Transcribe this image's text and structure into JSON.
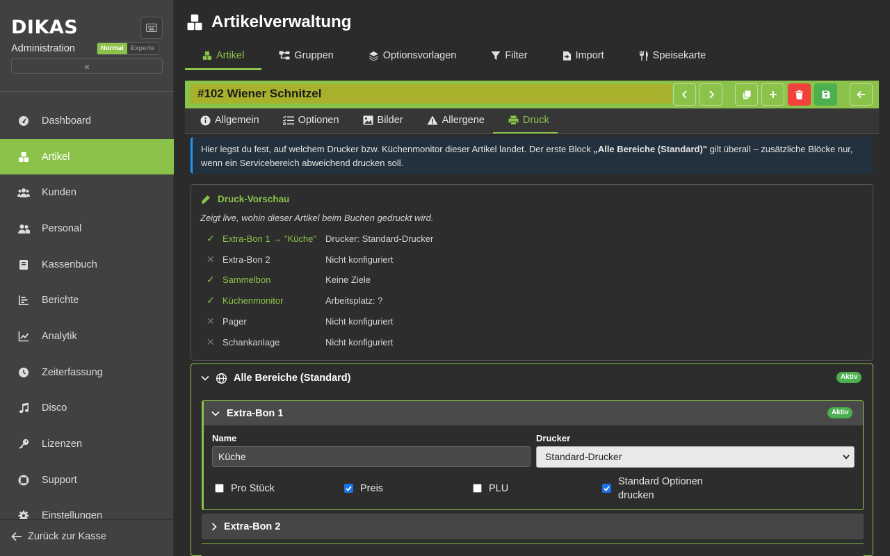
{
  "sidebar": {
    "logo": "DIKAS",
    "subtitle": "Administration",
    "mode_normal": "Normal",
    "mode_expert": "Experte",
    "collapse_symbol": "«",
    "items": [
      {
        "label": "Dashboard",
        "icon": "dashboard-icon"
      },
      {
        "label": "Artikel",
        "icon": "cubes-icon",
        "active": true
      },
      {
        "label": "Kunden",
        "icon": "users-icon"
      },
      {
        "label": "Personal",
        "icon": "user-group-icon"
      },
      {
        "label": "Kassenbuch",
        "icon": "book-icon"
      },
      {
        "label": "Berichte",
        "icon": "bar-chart-icon"
      },
      {
        "label": "Analytik",
        "icon": "line-chart-icon"
      },
      {
        "label": "Zeiterfassung",
        "icon": "clock-icon"
      },
      {
        "label": "Disco",
        "icon": "music-icon"
      },
      {
        "label": "Lizenzen",
        "icon": "key-icon"
      },
      {
        "label": "Support",
        "icon": "lifebuoy-icon"
      },
      {
        "label": "Einstellungen",
        "icon": "gear-icon"
      }
    ],
    "back_label": "Zurück zur Kasse"
  },
  "page": {
    "title": "Artikelverwaltung",
    "tabs": [
      {
        "label": "Artikel",
        "icon": "cubes-icon",
        "active": true
      },
      {
        "label": "Gruppen",
        "icon": "sitemap-icon"
      },
      {
        "label": "Optionsvorlagen",
        "icon": "layers-icon"
      },
      {
        "label": "Filter",
        "icon": "filter-icon"
      },
      {
        "label": "Import",
        "icon": "file-import-icon"
      },
      {
        "label": "Speisekarte",
        "icon": "utensils-icon"
      }
    ]
  },
  "article": {
    "name": "#102 Wiener Schnitzel",
    "subtabs": [
      {
        "label": "Allgemein",
        "icon": "info-circle-icon"
      },
      {
        "label": "Optionen",
        "icon": "list-check-icon"
      },
      {
        "label": "Bilder",
        "icon": "image-icon"
      },
      {
        "label": "Allergene",
        "icon": "warning-icon"
      },
      {
        "label": "Druck",
        "icon": "printer-icon",
        "active": true
      }
    ]
  },
  "info": {
    "text_1": "Hier legst du fest, auf welchem Drucker bzw. Küchenmonitor dieser Artikel landet. Der erste Block ",
    "text_bold": "„Alle Bereiche (Standard)\"",
    "text_2": " gilt überall – zusätzliche Blöcke nur, wenn ein Servicebereich abweichend drucken soll."
  },
  "preview": {
    "title": "Druck-Vorschau",
    "subtitle": "Zeigt live, wohin dieser Artikel beim Buchen gedruckt wird.",
    "rows": [
      {
        "status": "ok",
        "mark": "✓",
        "name": "Extra-Bon 1 → \"Küche\"",
        "desc": "Drucker: Standard-Drucker"
      },
      {
        "status": "no",
        "mark": "✕",
        "name": "Extra-Bon 2",
        "desc": "Nicht konfiguriert"
      },
      {
        "status": "ok",
        "mark": "✓",
        "name": "Sammelbon",
        "desc": "Keine Ziele"
      },
      {
        "status": "ok",
        "mark": "✓",
        "name": "Küchenmonitor",
        "desc": "Arbeitsplatz: ?"
      },
      {
        "status": "no",
        "mark": "✕",
        "name": "Pager",
        "desc": "Nicht konfiguriert"
      },
      {
        "status": "no",
        "mark": "✕",
        "name": "Schankanlage",
        "desc": "Nicht konfiguriert"
      }
    ]
  },
  "region": {
    "title": "Alle Bereiche (Standard)",
    "badge": "Aktiv",
    "extra_bon_1": {
      "title": "Extra-Bon 1",
      "badge": "Aktiv",
      "name_label": "Name",
      "name_value": "Küche",
      "printer_label": "Drucker",
      "printer_value": "Standard-Drucker",
      "checkboxes": [
        {
          "label": "Pro Stück",
          "checked": false
        },
        {
          "label": "Preis",
          "checked": true
        },
        {
          "label": "PLU",
          "checked": false
        },
        {
          "label": "Standard Optionen drucken",
          "checked": true
        }
      ]
    },
    "extra_bon_2": {
      "title": "Extra-Bon 2"
    }
  },
  "colors": {
    "accent": "#8bc34a",
    "danger": "#f0413a",
    "success": "#4caf50",
    "info": "#2196f3"
  }
}
